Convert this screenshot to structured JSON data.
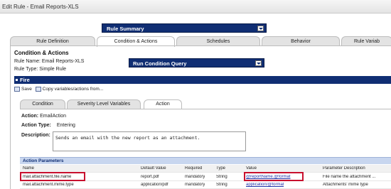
{
  "window": {
    "title": "Edit Rule - Email Reports-XLS"
  },
  "summary_dropdown": {
    "label": "Rule Summary"
  },
  "tabs": [
    {
      "label": "Rule Definition",
      "active": false
    },
    {
      "label": "Condition & Actions",
      "active": true
    },
    {
      "label": "Schedules",
      "active": false
    },
    {
      "label": "Behavior",
      "active": false
    },
    {
      "label": "Rule Variab",
      "active": false
    }
  ],
  "section": {
    "title": "Condition & Actions",
    "rule_name_label": "Rule Name:",
    "rule_name": "Email Reports-XLS",
    "rule_type_label": "Rule Type:",
    "rule_type": "Simple Rule",
    "run_button": "Run Condition Query"
  },
  "fire": {
    "title": "Fire",
    "save_label": "Save",
    "copy_label": "Copy variables/actions from...",
    "inner_tabs": [
      {
        "label": "Condition",
        "active": false
      },
      {
        "label": "Severity Level Variables",
        "active": false
      },
      {
        "label": "Action",
        "active": true
      }
    ],
    "action_label": "Action:",
    "action_value": "EmailAction",
    "action_type_label": "Action Type:",
    "action_type_value": "Entering",
    "description_label": "Description:",
    "description_value": "Sends an email with the new report as an attachment."
  },
  "params": {
    "title": "Action Parameters",
    "columns": [
      "Name",
      "Default Value",
      "Required",
      "Type",
      "Value",
      "Parameter Description"
    ],
    "rows": [
      [
        "mail.attachment.file.name",
        "report.pdf",
        "mandatory",
        "String",
        "@reportName.@format",
        "File name the attachment ..."
      ],
      [
        "mail.attachment.mime.type",
        "application/pdf",
        "mandatory",
        "String",
        "application/@format",
        "Attachments' mime type"
      ]
    ]
  },
  "colors": {
    "navy": "#102e73",
    "highlight": "#c8102e",
    "link": "#2233aa"
  }
}
